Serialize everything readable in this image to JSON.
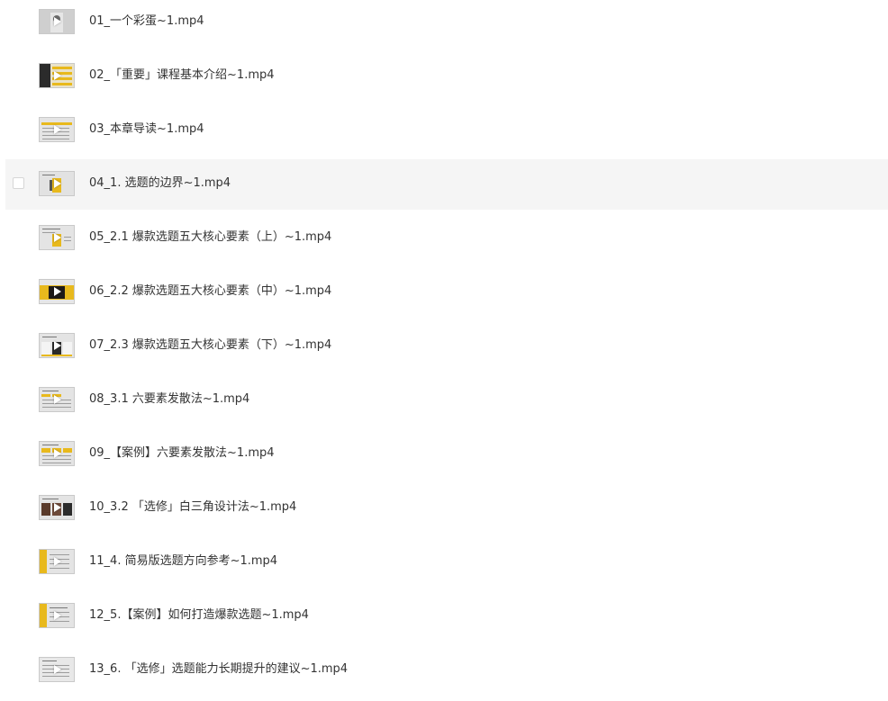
{
  "files": [
    {
      "name": "01_一个彩蛋~1.mp4",
      "thumb_icon": "video-thumbnail-icon"
    },
    {
      "name": "02_「重要」课程基本介绍~1.mp4",
      "thumb_icon": "video-thumbnail-icon"
    },
    {
      "name": "03_本章导读~1.mp4",
      "thumb_icon": "video-thumbnail-icon"
    },
    {
      "name": "04_1. 选题的边界~1.mp4",
      "thumb_icon": "video-thumbnail-icon",
      "hovered": true
    },
    {
      "name": "05_2.1 爆款选题五大核心要素（上）~1.mp4",
      "thumb_icon": "video-thumbnail-icon"
    },
    {
      "name": "06_2.2 爆款选题五大核心要素（中）~1.mp4",
      "thumb_icon": "video-thumbnail-icon"
    },
    {
      "name": "07_2.3 爆款选题五大核心要素（下）~1.mp4",
      "thumb_icon": "video-thumbnail-icon"
    },
    {
      "name": "08_3.1 六要素发散法~1.mp4",
      "thumb_icon": "video-thumbnail-icon"
    },
    {
      "name": "09_【案例】六要素发散法~1.mp4",
      "thumb_icon": "video-thumbnail-icon"
    },
    {
      "name": "10_3.2 「选修」白三角设计法~1.mp4",
      "thumb_icon": "video-thumbnail-icon"
    },
    {
      "name": "11_4. 简易版选题方向参考~1.mp4",
      "thumb_icon": "video-thumbnail-icon"
    },
    {
      "name": "12_5.【案例】如何打造爆款选题~1.mp4",
      "thumb_icon": "video-thumbnail-icon"
    },
    {
      "name": "13_6. 「选修」选题能力长期提升的建议~1.mp4",
      "thumb_icon": "video-thumbnail-icon"
    }
  ],
  "colors": {
    "row_hover_bg": "#f5f5f5",
    "text": "#333333",
    "thumb_accent": "#e8b91d"
  }
}
